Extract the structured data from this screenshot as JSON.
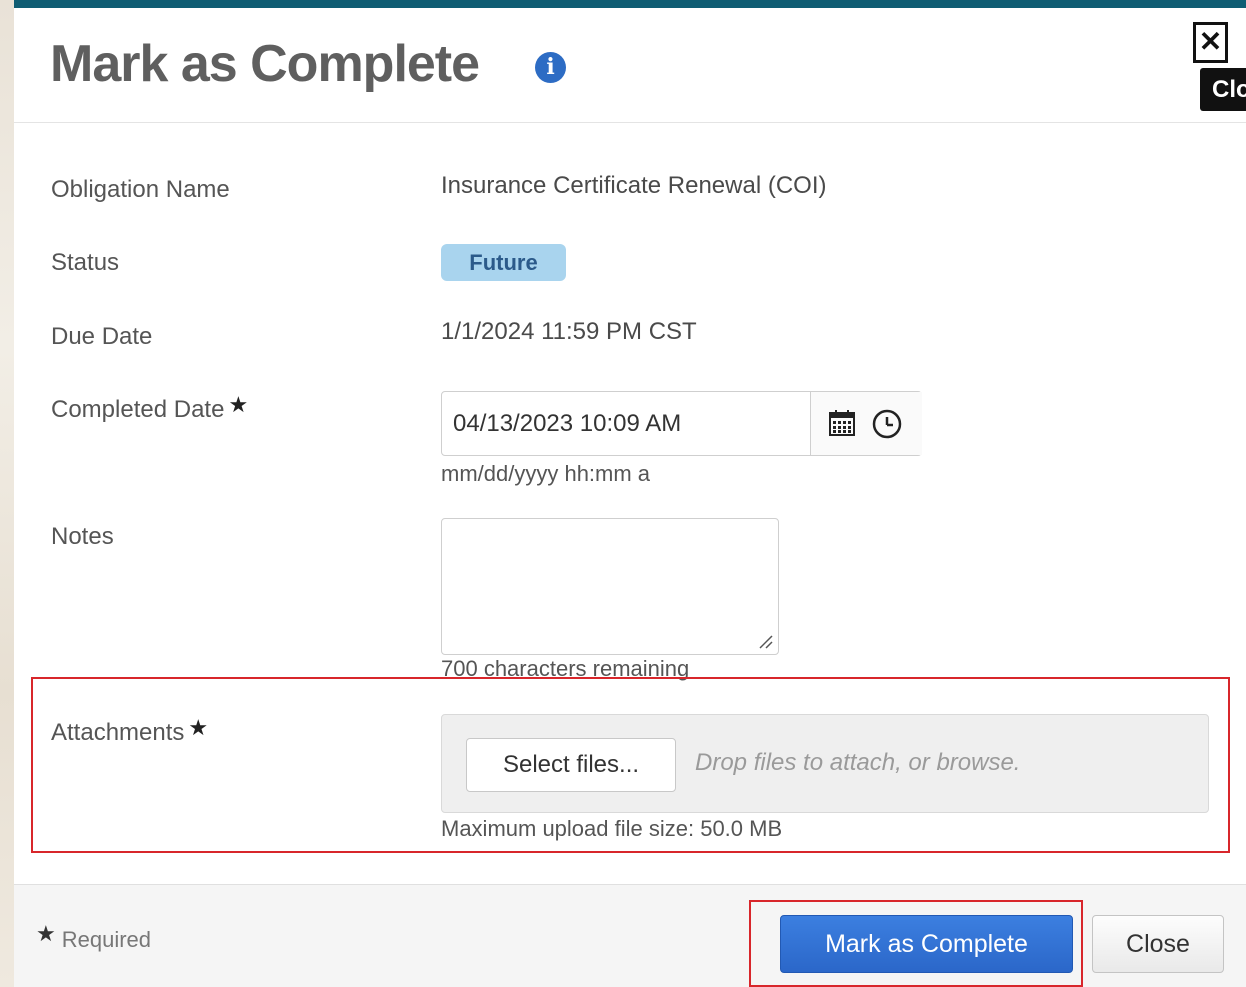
{
  "dialog": {
    "title": "Mark as Complete",
    "close_tooltip": "Close"
  },
  "fields": {
    "obligation_name": {
      "label": "Obligation Name",
      "value": "Insurance Certificate Renewal (COI)"
    },
    "status": {
      "label": "Status",
      "value": "Future"
    },
    "due_date": {
      "label": "Due Date",
      "value": "1/1/2024 11:59 PM CST"
    },
    "completed_date": {
      "label": "Completed Date",
      "value": "04/13/2023 10:09 AM",
      "format_hint": "mm/dd/yyyy hh:mm a"
    },
    "notes": {
      "label": "Notes",
      "value": "",
      "remaining": "700 characters remaining"
    },
    "attachments": {
      "label": "Attachments",
      "select_button": "Select files...",
      "drop_hint": "Drop files to attach, or browse.",
      "max_size": "Maximum upload file size: 50.0 MB"
    }
  },
  "required_marker": "★",
  "footer": {
    "required_note": "Required",
    "primary_button": "Mark as Complete",
    "secondary_button": "Close"
  },
  "colors": {
    "primary": "#2b67c9",
    "status_badge": "#a9d4ee",
    "highlight": "#d8262b",
    "backdrop": "#0f5d73"
  }
}
